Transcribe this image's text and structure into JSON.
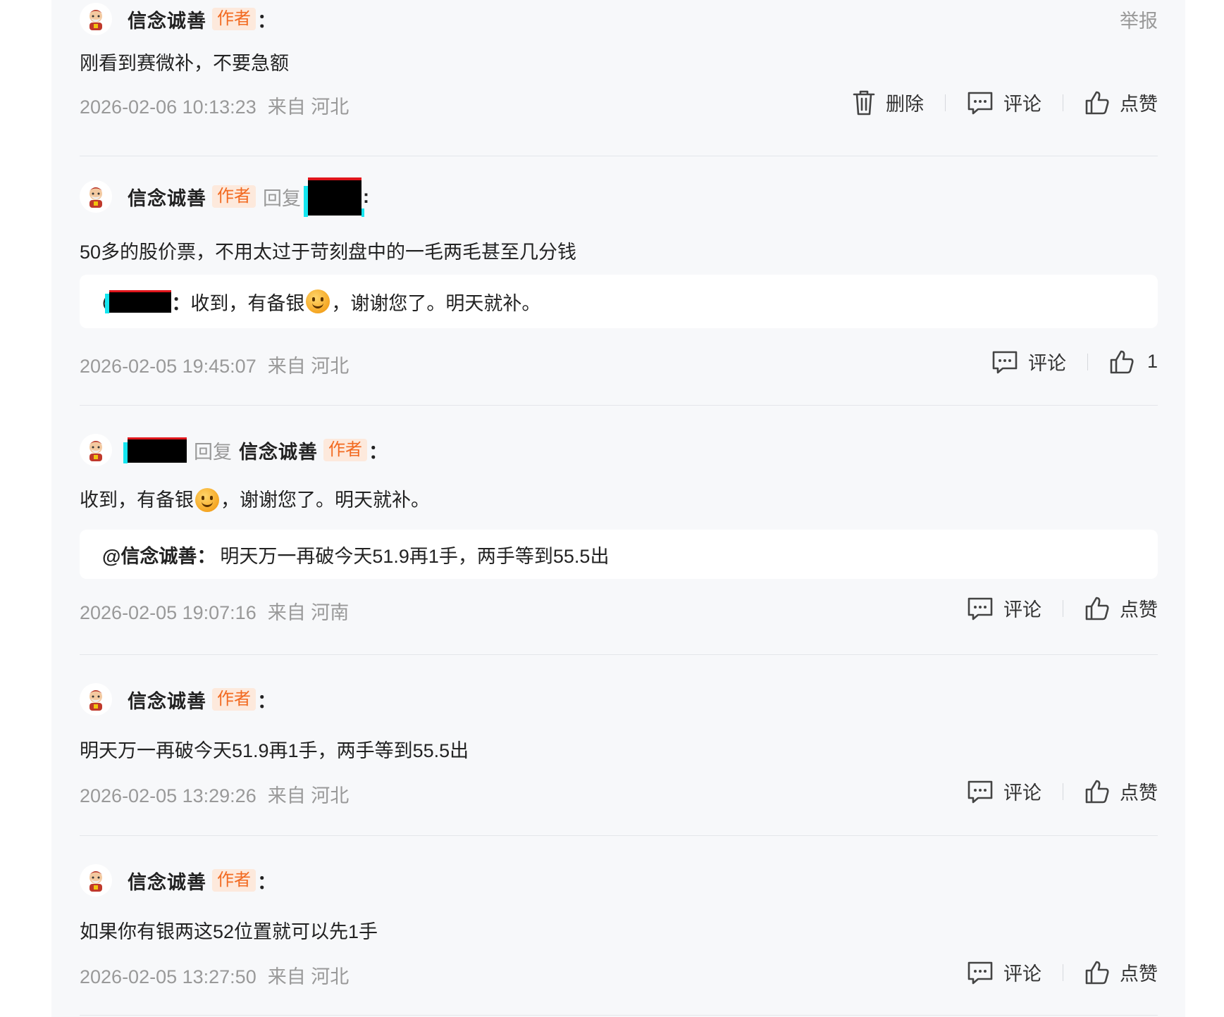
{
  "comments": [
    {
      "username": "信念诚善",
      "author_tag": "作者",
      "colon": "：",
      "report": "举报",
      "text": "刚看到赛微补，不要急额",
      "timestamp": "2026-02-06 10:13:23",
      "location": "来自 河北",
      "delete_label": "删除",
      "comment_label": "评论",
      "like_label": "点赞"
    },
    {
      "username": "信念诚善",
      "author_tag": "作者",
      "reply_word": "回复",
      "colon": ":",
      "text": "50多的股价票，不用太过于苛刻盘中的一毛两毛甚至几分钱",
      "quote_prefix": "@",
      "quote_colon": "：",
      "quote_text_1": "收到，有备银",
      "quote_text_2": "，谢谢您了。明天就补。",
      "timestamp": "2026-02-05 19:45:07",
      "location": "来自 河北",
      "comment_label": "评论",
      "like_count": "1"
    },
    {
      "reply_word": "回复",
      "reply_to": "信念诚善",
      "author_tag": "作者",
      "colon": "：",
      "text_1": "收到，有备银",
      "text_2": "，谢谢您了。明天就补。",
      "quote_user": "@信念诚善：",
      "quote_text": "明天万一再破今天51.9再1手，两手等到55.5出",
      "timestamp": "2026-02-05 19:07:16",
      "location": "来自 河南",
      "comment_label": "评论",
      "like_label": "点赞"
    },
    {
      "username": "信念诚善",
      "author_tag": "作者",
      "colon": "：",
      "text": "明天万一再破今天51.9再1手，两手等到55.5出",
      "timestamp": "2026-02-05 13:29:26",
      "location": "来自 河北",
      "comment_label": "评论",
      "like_label": "点赞"
    },
    {
      "username": "信念诚善",
      "author_tag": "作者",
      "colon": "：",
      "text": "如果你有银两这52位置就可以先1手",
      "timestamp": "2026-02-05 13:27:50",
      "location": "来自 河北",
      "comment_label": "评论",
      "like_label": "点赞"
    }
  ],
  "icons": {
    "delete": "trash-icon",
    "comment": "comment-bubble-icon",
    "like": "thumbs-up-icon",
    "emoji": "smile-emoji-icon",
    "avatar": "avatar-cartoon-icon"
  },
  "colors": {
    "author_tag_text": "#f26a21",
    "author_tag_bg": "#fde9dc",
    "panel_bg": "#f7f8fa",
    "meta_text": "#999999",
    "redaction": "#000000"
  }
}
